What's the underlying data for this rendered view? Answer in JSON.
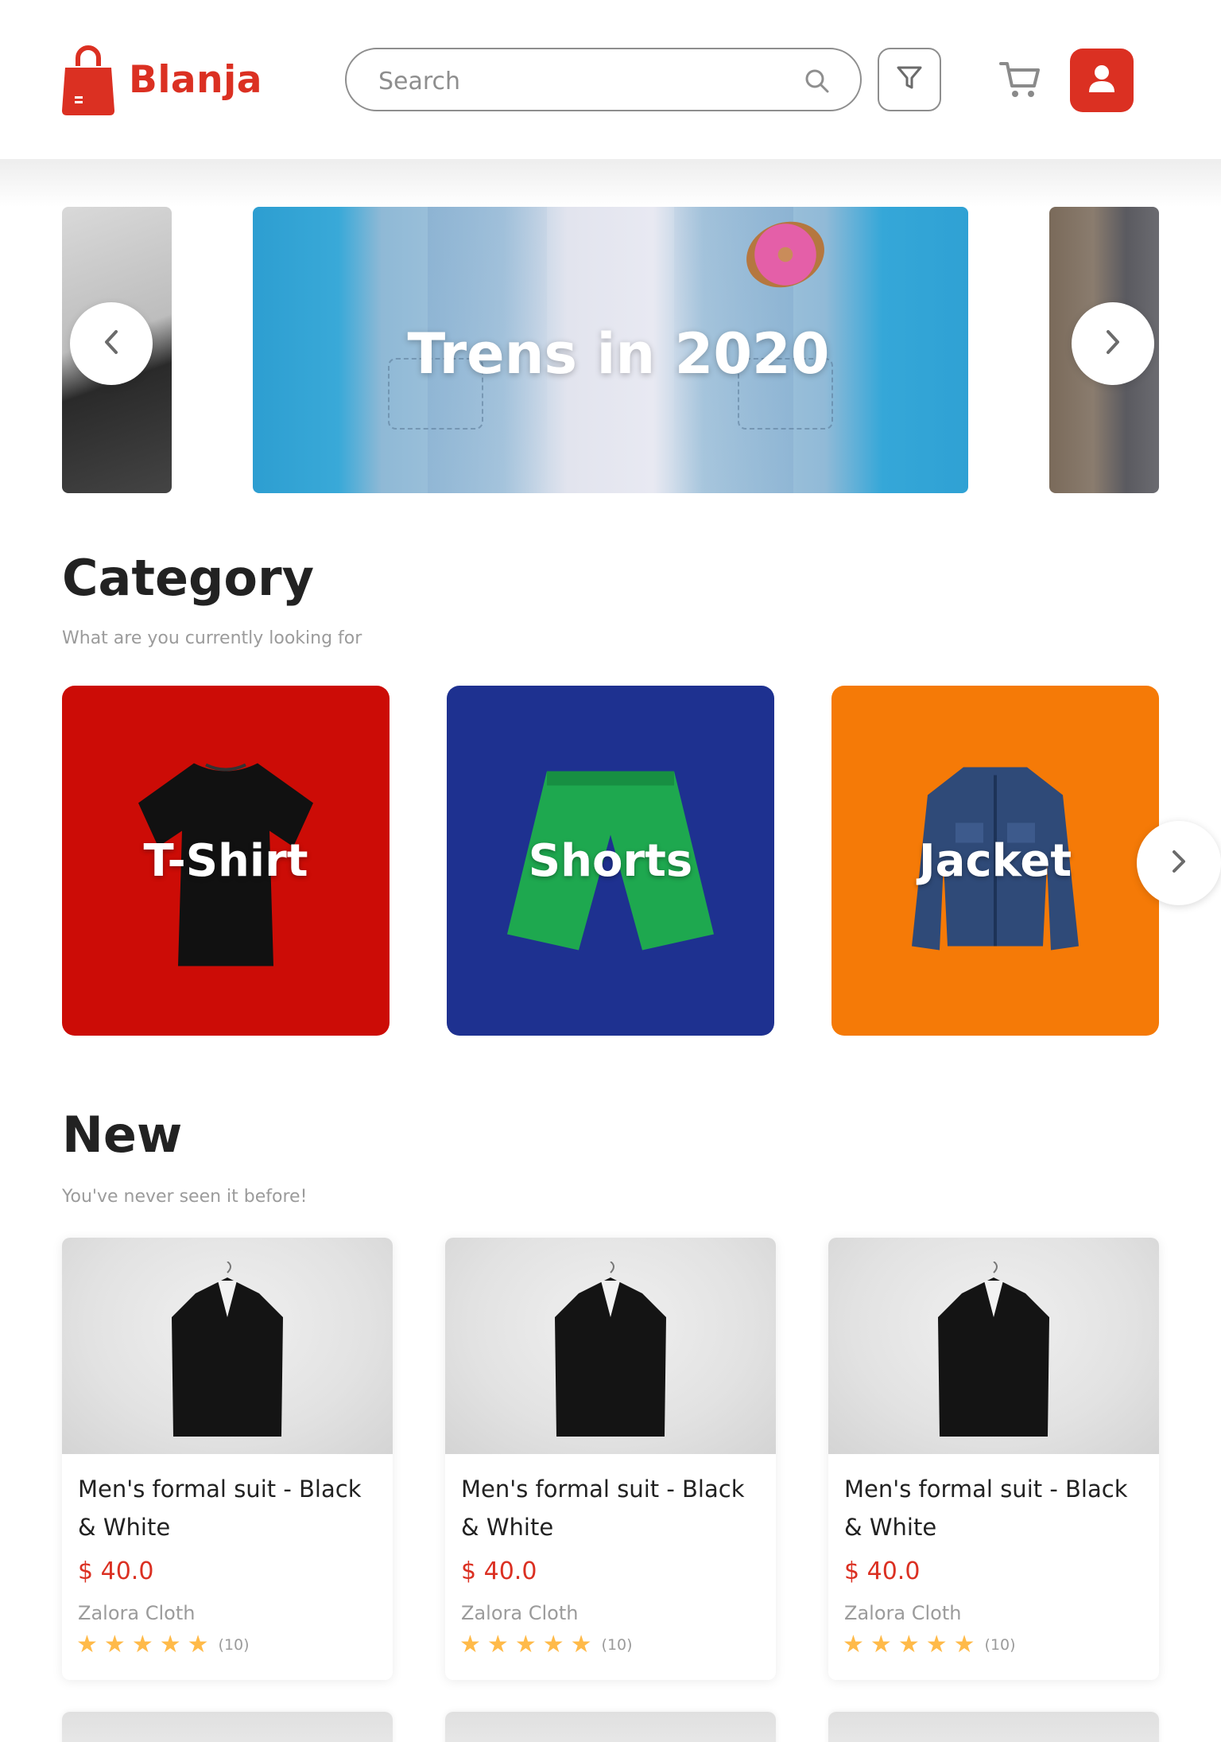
{
  "header": {
    "brand": "Blanja",
    "search_placeholder": "Search",
    "icons": [
      "bag-logo-icon",
      "search-icon",
      "filter-icon",
      "cart-icon",
      "user-icon"
    ],
    "accent_color": "#db3022"
  },
  "carousel": {
    "main_title": "Trens in 2020",
    "prev_label": "previous",
    "next_label": "next"
  },
  "category": {
    "title": "Category",
    "subtitle": "What are you currently looking for",
    "items": [
      {
        "label": "T-Shirt",
        "color": "#cc0c06"
      },
      {
        "label": "Shorts",
        "color": "#1e3190"
      },
      {
        "label": "Jacket",
        "color": "#f57a07"
      }
    ]
  },
  "new": {
    "title": "New",
    "subtitle": "You've never seen it before!",
    "products": [
      {
        "name": "Men's formal suit - Black & White",
        "price": "$ 40.0",
        "brand": "Zalora Cloth",
        "stars": 5,
        "rating_count": "(10)"
      },
      {
        "name": "Men's formal suit - Black & White",
        "price": "$ 40.0",
        "brand": "Zalora Cloth",
        "stars": 5,
        "rating_count": "(10)"
      },
      {
        "name": "Men's formal suit - Black & White",
        "price": "$ 40.0",
        "brand": "Zalora Cloth",
        "stars": 5,
        "rating_count": "(10)"
      }
    ]
  }
}
